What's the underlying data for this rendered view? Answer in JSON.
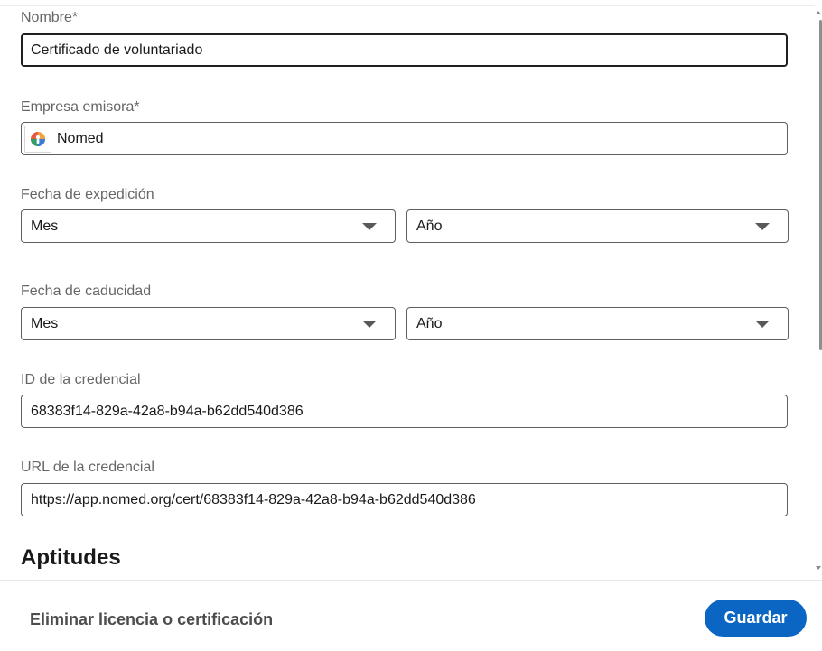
{
  "form": {
    "name": {
      "label": "Nombre*",
      "value": "Certificado de voluntariado"
    },
    "issuer": {
      "label": "Empresa emisora*",
      "value": "Nomed",
      "logo_icon": "nomed-logo-icon"
    },
    "issue_date": {
      "label": "Fecha de expedición",
      "month_value": "Mes",
      "year_value": "Año"
    },
    "expiration_date": {
      "label": "Fecha de caducidad",
      "month_value": "Mes",
      "year_value": "Año"
    },
    "credential_id": {
      "label": "ID de la credencial",
      "value": "68383f14-829a-42a8-b94a-b62dd540d386"
    },
    "credential_url": {
      "label": "URL de la credencial",
      "value": "https://app.nomed.org/cert/68383f14-829a-42a8-b94a-b62dd540d386"
    },
    "skills_section": {
      "title": "Aptitudes"
    }
  },
  "footer": {
    "delete_label": "Eliminar licencia o certificación",
    "save_label": "Guardar"
  },
  "colors": {
    "primary_button": "#0a66c2",
    "label_text": "#666666",
    "border": "#5e5e5e"
  }
}
